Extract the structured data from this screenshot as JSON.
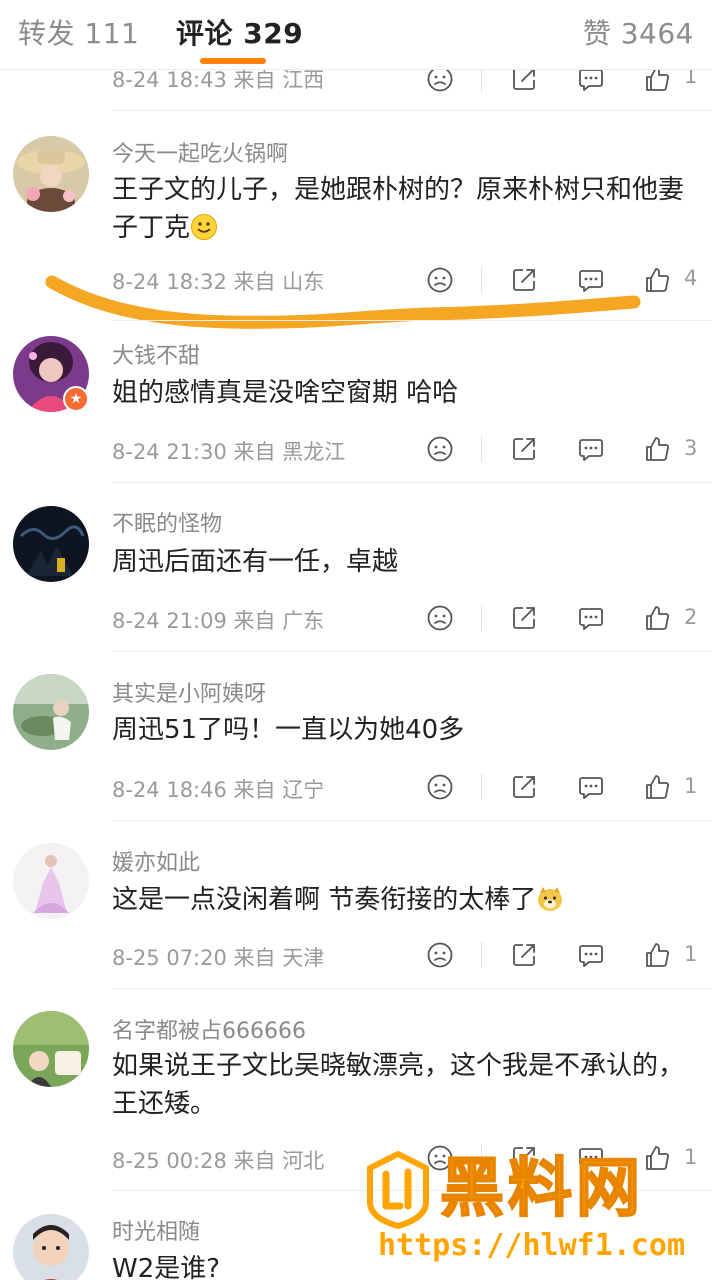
{
  "tabs": {
    "repost": "转发 111",
    "comments": "评论 329",
    "likes": "赞 3464"
  },
  "top_partial": {
    "meta": "8-24 18:43 来自 江西",
    "likes": "1"
  },
  "comments": [
    {
      "username": "今天一起吃火锅啊",
      "text": "王子文的儿子，是她跟朴树的？原来朴树只和他妻子丁克",
      "emoji": "smile-emoji",
      "meta": "8-24 18:32 来自 山东",
      "likes": "4"
    },
    {
      "username": "大钱不甜",
      "text": "姐的感情真是没啥空窗期 哈哈",
      "meta": "8-24 21:30 来自 黑龙江",
      "likes": "3"
    },
    {
      "username": "不眠的怪物",
      "text": "周迅后面还有一任，卓越",
      "meta": "8-24 21:09 来自 广东",
      "likes": "2"
    },
    {
      "username": "其实是小阿姨呀",
      "text": "周迅51了吗！一直以为她40多",
      "meta": "8-24 18:46 来自 辽宁",
      "likes": "1"
    },
    {
      "username": "媛亦如此",
      "text": "这是一点没闲着啊 节奏衔接的太棒了",
      "emoji": "doge-emoji",
      "meta": "8-25 07:20 来自 天津",
      "likes": "1"
    },
    {
      "username": "名字都被占666666",
      "text": "如果说王子文比吴晓敏漂亮，这个我是不承认的，王还矮。",
      "meta": "8-25 00:28 来自 河北",
      "likes": "1"
    },
    {
      "username": "时光相随",
      "text": "W2是谁?"
    }
  ],
  "watermark": {
    "brand": "黑料网",
    "url": "https://hlwf1.com"
  },
  "colors": {
    "accent": "#ff8200",
    "highlight_stroke": "#f5a623",
    "watermark": "#ffa400"
  }
}
